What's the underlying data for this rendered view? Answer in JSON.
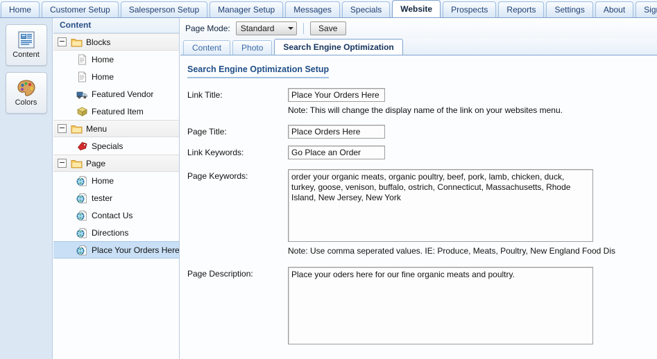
{
  "top_tabs": [
    {
      "label": "Home",
      "active": false
    },
    {
      "label": "Customer Setup",
      "active": false
    },
    {
      "label": "Salesperson Setup",
      "active": false
    },
    {
      "label": "Manager Setup",
      "active": false
    },
    {
      "label": "Messages",
      "active": false
    },
    {
      "label": "Specials",
      "active": false
    },
    {
      "label": "Website",
      "active": true
    },
    {
      "label": "Prospects",
      "active": false
    },
    {
      "label": "Reports",
      "active": false
    },
    {
      "label": "Settings",
      "active": false
    },
    {
      "label": "About",
      "active": false
    },
    {
      "label": "Sign Out",
      "active": false
    }
  ],
  "rail": {
    "buttons": [
      {
        "label": "Content",
        "icon": "document-content-icon"
      },
      {
        "label": "Colors",
        "icon": "color-palette-icon"
      }
    ]
  },
  "tree": {
    "header": "Content",
    "nodes": [
      {
        "label": "Blocks",
        "type": "group",
        "icon": "folder-icon",
        "expanded": true,
        "selected": false
      },
      {
        "label": "Home",
        "type": "child",
        "icon": "page-document-icon",
        "selected": false
      },
      {
        "label": "Home",
        "type": "child",
        "icon": "page-document-icon",
        "selected": false
      },
      {
        "label": "Featured Vendor",
        "type": "child",
        "icon": "truck-icon",
        "selected": false
      },
      {
        "label": "Featured Item",
        "type": "child",
        "icon": "package-box-icon",
        "selected": false
      },
      {
        "label": "Menu",
        "type": "group",
        "icon": "folder-icon",
        "expanded": true,
        "selected": false
      },
      {
        "label": "Specials",
        "type": "child",
        "icon": "tag-icon",
        "selected": false
      },
      {
        "label": "Page",
        "type": "group",
        "icon": "folder-icon",
        "expanded": true,
        "selected": false
      },
      {
        "label": "Home",
        "type": "child",
        "icon": "globe-page-icon",
        "selected": false
      },
      {
        "label": "tester",
        "type": "child",
        "icon": "globe-page-icon",
        "selected": false
      },
      {
        "label": "Contact Us",
        "type": "child",
        "icon": "globe-page-icon",
        "selected": false
      },
      {
        "label": "Directions",
        "type": "child",
        "icon": "globe-page-icon",
        "selected": false
      },
      {
        "label": "Place Your Orders Here",
        "type": "child",
        "icon": "globe-page-icon",
        "selected": true
      }
    ]
  },
  "toolbar": {
    "page_mode_label": "Page Mode:",
    "page_mode_value": "Standard",
    "save_label": "Save"
  },
  "sub_tabs": [
    {
      "label": "Content",
      "active": false
    },
    {
      "label": "Photo",
      "active": false
    },
    {
      "label": "Search Engine Optimization",
      "active": true
    }
  ],
  "form": {
    "title": "Search Engine Optimization Setup",
    "link_title_label": "Link Title:",
    "link_title_value": "Place Your Orders Here",
    "link_title_note": "Note: This will change the display name of the link on your websites menu.",
    "page_title_label": "Page Title:",
    "page_title_value": "Place Orders Here",
    "link_keywords_label": "Link Keywords:",
    "link_keywords_value": "Go Place an Order",
    "page_keywords_label": "Page Keywords:",
    "page_keywords_value": "order your organic meats, organic poultry, beef, pork, lamb, chicken, duck, turkey, goose, venison, buffalo, ostrich, Connecticut, Massachusetts, Rhode Island, New Jersey, New York",
    "page_keywords_note": "Note: Use comma seperated values. IE: Produce, Meats, Poultry, New England Food Dis",
    "page_description_label": "Page Description:",
    "page_description_value": "Place your oders here for our fine organic meats and poultry."
  },
  "colors": {
    "accent_blue": "#1f4e87",
    "tab_border": "#7da2ce",
    "rail_bg": "#dce7f4",
    "selection": "#c9dff5"
  }
}
